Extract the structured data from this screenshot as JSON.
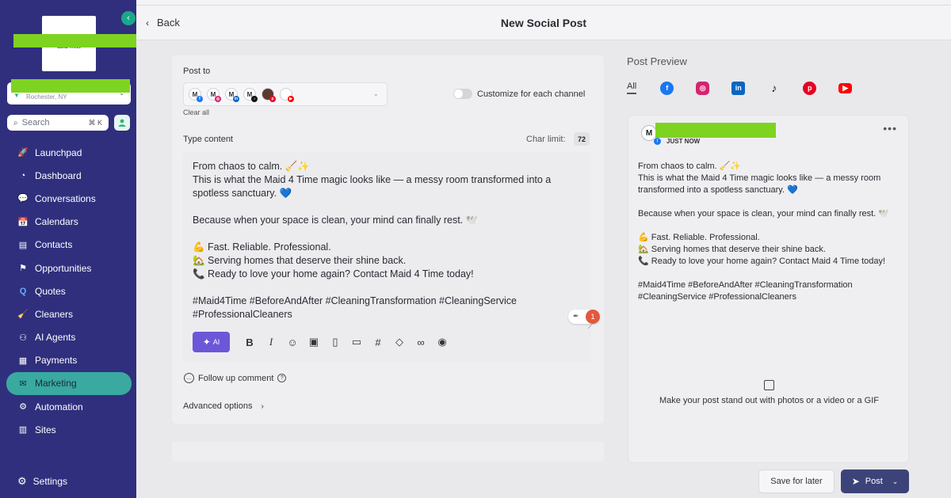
{
  "sidebar": {
    "logo_text": "LEAD TITAN",
    "location_sub": "Rochester, NY",
    "search_placeholder": "Search",
    "search_shortcut": "⌘ K",
    "items": [
      {
        "label": "Launchpad",
        "icon": "rocket-icon"
      },
      {
        "label": "Dashboard",
        "icon": "gauge-icon"
      },
      {
        "label": "Conversations",
        "icon": "chat-icon"
      },
      {
        "label": "Calendars",
        "icon": "calendar-icon"
      },
      {
        "label": "Contacts",
        "icon": "contact-card-icon"
      },
      {
        "label": "Opportunities",
        "icon": "opportunities-icon"
      },
      {
        "label": "Quotes",
        "icon": "quotes-icon"
      },
      {
        "label": "Cleaners",
        "icon": "broom-icon"
      },
      {
        "label": "AI Agents",
        "icon": "robot-icon"
      },
      {
        "label": "Payments",
        "icon": "payments-icon"
      },
      {
        "label": "Marketing",
        "icon": "mail-icon",
        "active": true
      },
      {
        "label": "Automation",
        "icon": "workflow-icon"
      },
      {
        "label": "Sites",
        "icon": "sites-icon"
      }
    ],
    "settings_label": "Settings"
  },
  "header": {
    "back_label": "Back",
    "title": "New Social Post"
  },
  "composer": {
    "post_to_label": "Post to",
    "clear_all_label": "Clear all",
    "customize_label": "Customize for each channel",
    "customize_on": false,
    "type_content_label": "Type content",
    "char_limit_label": "Char limit:",
    "char_limit_value": "72",
    "content_lines": [
      "From chaos to calm. 🧹✨",
      "This is what the Maid 4 Time magic looks like — a messy room transformed into a spotless sanctuary. 💙",
      "",
      "Because when your space is clean, your mind can finally rest. 🕊️",
      "",
      "💪 Fast. Reliable. Professional.",
      "🏡 Serving homes that deserve their shine back.",
      "📞 Ready to love your home again? Contact Maid 4 Time today!",
      "",
      "#Maid4Time #BeforeAndAfter #CleaningTransformation #CleaningService #ProfessionalCleaners"
    ],
    "issue_count": "1",
    "ai_label": "AI",
    "followup_label": "Follow up comment",
    "advanced_label": "Advanced options"
  },
  "preview": {
    "title": "Post Preview",
    "tab_all": "All",
    "time_label": "JUST NOW",
    "content_lines": [
      "From chaos to calm. 🧹✨",
      "This is what the Maid 4 Time magic looks like — a messy room transformed into a spotless sanctuary. 💙",
      "",
      "Because when your space is clean, your mind can finally rest. 🕊️",
      "",
      "💪 Fast. Reliable. Professional.",
      "🏡 Serving homes that deserve their shine back.",
      "📞 Ready to love your home again? Contact Maid 4 Time today!",
      "",
      "#Maid4Time #BeforeAndAfter #CleaningTransformation #CleaningService #ProfessionalCleaners"
    ],
    "media_prompt": "Make your post stand out with photos or a video or a GIF"
  },
  "footer": {
    "save_later_label": "Save for later",
    "post_label": "Post"
  },
  "colors": {
    "sidebar_bg": "#2f2f7e",
    "active_nav": "#3aa9a0",
    "post_button": "#3c4378",
    "ai_button": "#6b57d8",
    "redaction": "#7ed321"
  }
}
